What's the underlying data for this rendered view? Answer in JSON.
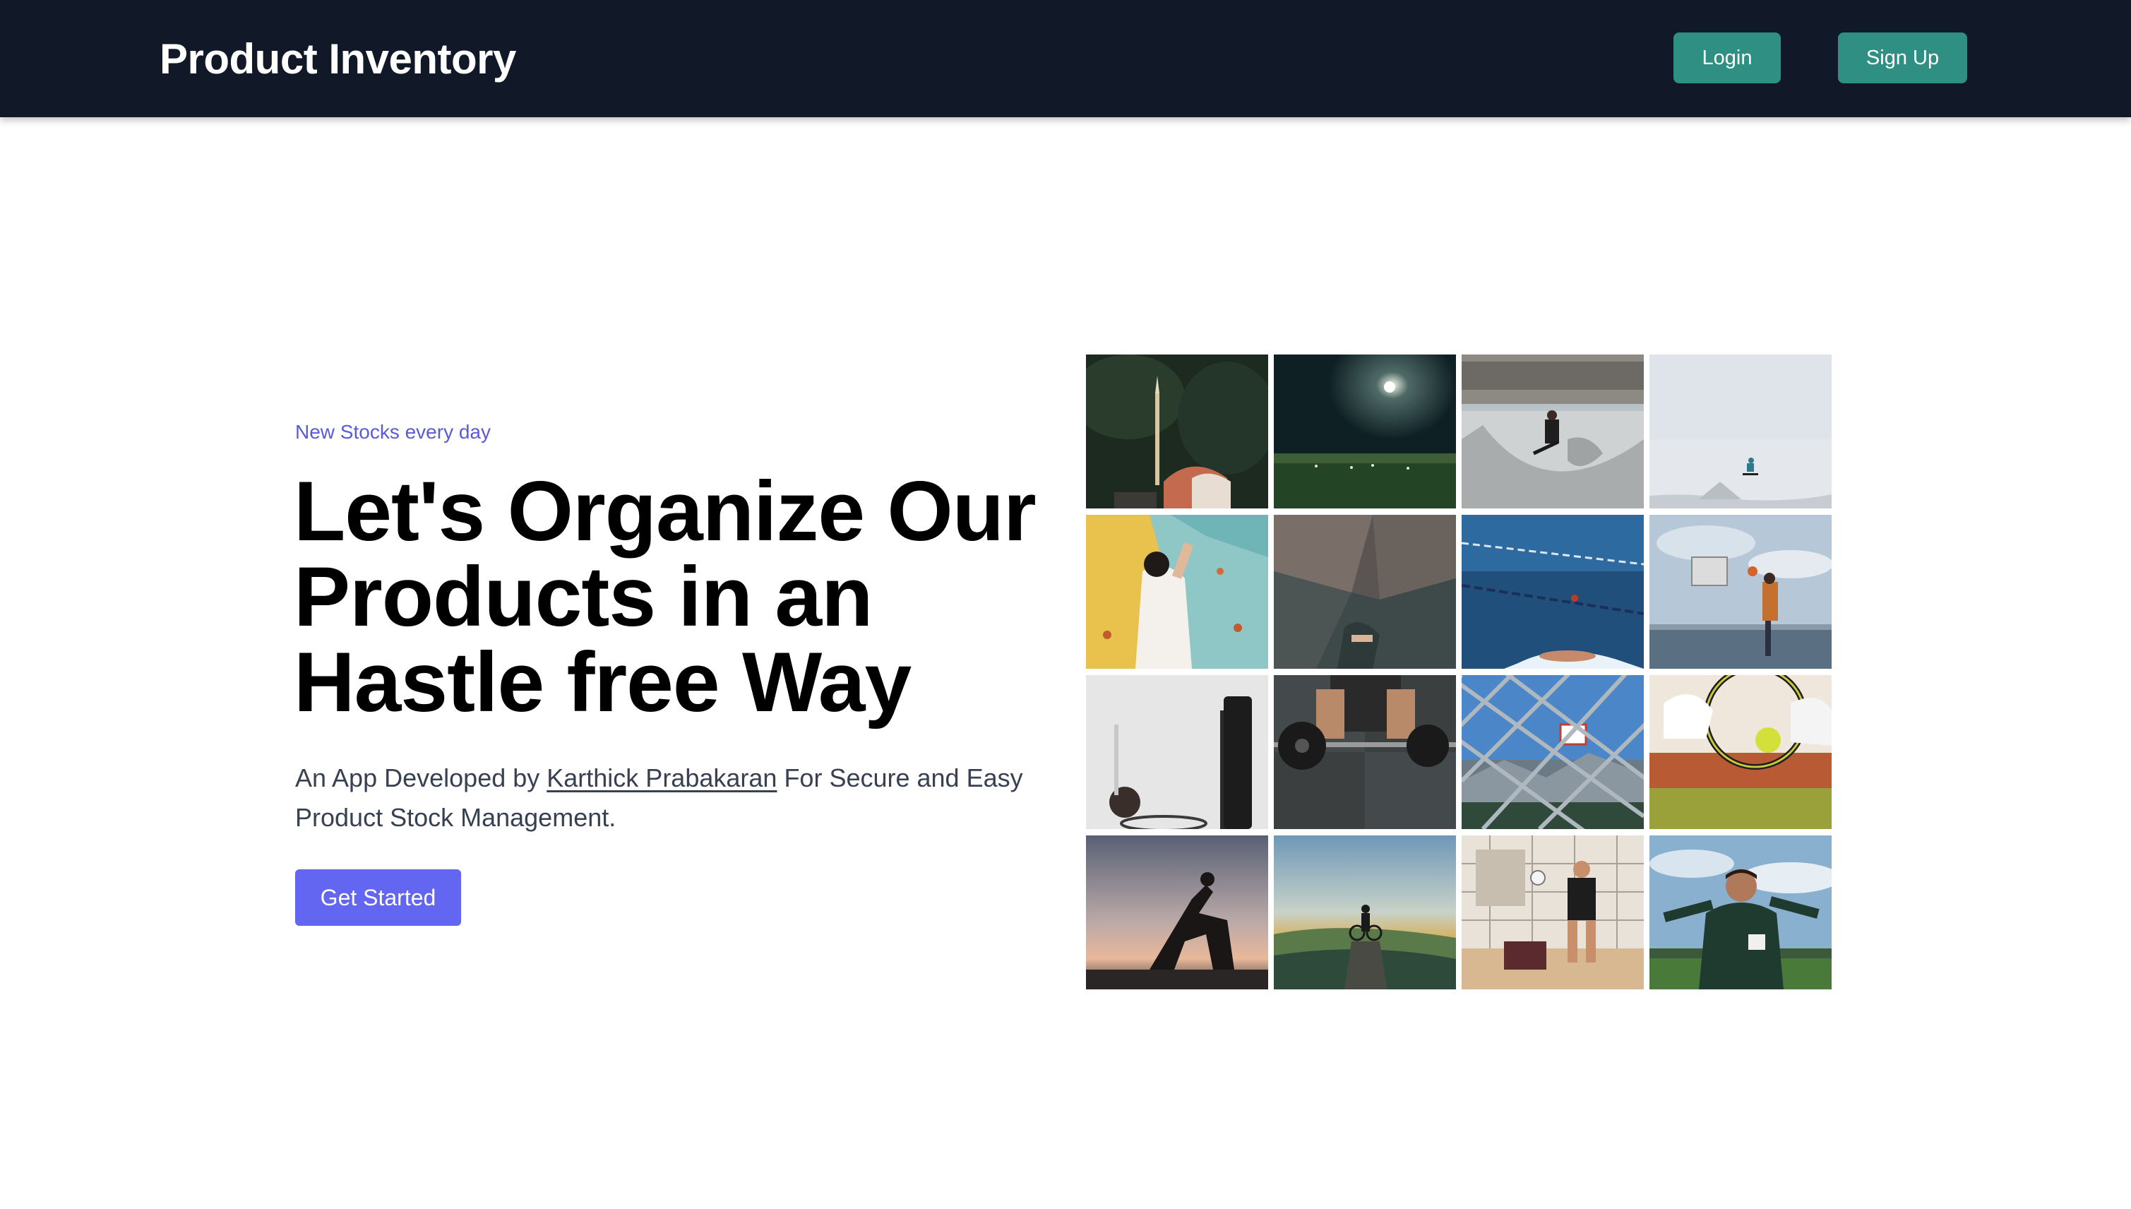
{
  "header": {
    "brand": "Product Inventory",
    "login_label": "Login",
    "signup_label": "Sign Up"
  },
  "hero": {
    "eyebrow": "New Stocks every day",
    "headline_lines": [
      "Let's Organize Our",
      "Products in an",
      "Hastle free Way"
    ],
    "description_prefix": "An App Developed by ",
    "author_link": "Karthick Prabakaran",
    "description_suffix": " For Secure and Easy Product Stock Management.",
    "cta_label": "Get Started"
  },
  "colors": {
    "navbar_bg": "#111827",
    "nav_button": "#2f8f83",
    "accent": "#6366f1",
    "eyebrow": "#5b5bd6"
  },
  "gallery": {
    "photos": [
      "archery-photo",
      "night-soccer-field-photo",
      "skatepark-photo",
      "skier-jump-photo",
      "rock-climbing-wall-photo",
      "bouldering-photo",
      "swimming-pool-photo",
      "basketball-dunk-photo",
      "basketball-hoop-photo",
      "weightlifting-photo",
      "chain-fence-basketball-photo",
      "tennis-racket-photo",
      "yoga-silhouette-photo",
      "mountain-biker-photo",
      "volleyball-photo",
      "soccer-player-photo"
    ]
  }
}
